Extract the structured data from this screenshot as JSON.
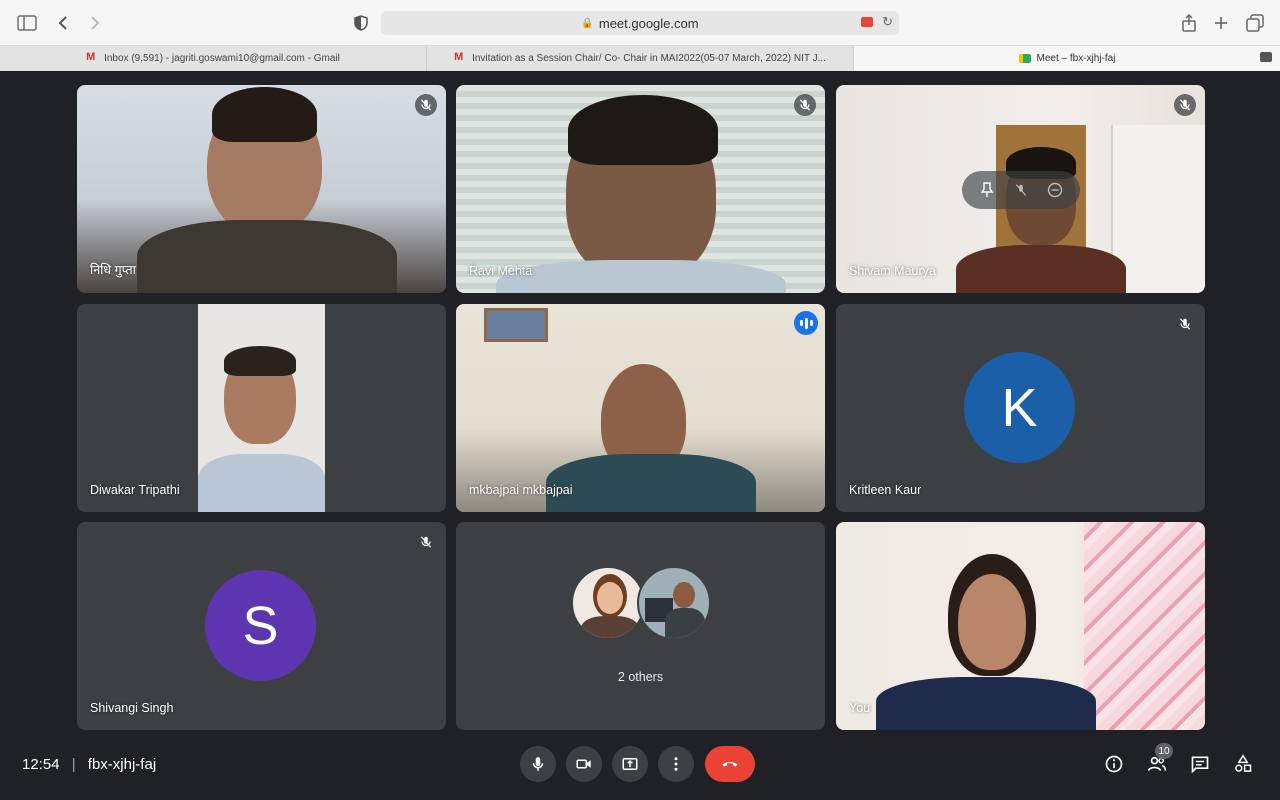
{
  "browser": {
    "url": "meet.google.com",
    "tabs": [
      {
        "label": "Inbox (9,591) - jagriti.goswami10@gmail.com - Gmail",
        "icon": "gmail-icon"
      },
      {
        "label": "Invitation as a Session Chair/ Co- Chair in MAI2022(05-07 March, 2022) NIT J...",
        "icon": "gmail-icon"
      },
      {
        "label": "Meet – fbx-xjhj-faj",
        "icon": "meet-icon"
      }
    ]
  },
  "participants": [
    {
      "name": "निधि गुप्ता",
      "muted": true
    },
    {
      "name": "Ravi Mehta",
      "muted": true
    },
    {
      "name": "Shivam Maurya",
      "muted": true
    },
    {
      "name": "Diwakar Tripathi",
      "muted": false
    },
    {
      "name": "mkbajpai mkbajpai",
      "muted": false,
      "speaking": true
    },
    {
      "name": "Kritleen Kaur",
      "muted": true,
      "initial": "K",
      "avatar_color": "#1a5fa8"
    },
    {
      "name": "Shivangi Singh",
      "muted": true,
      "initial": "S",
      "avatar_color": "#5e35b1"
    },
    {
      "name": "2 others"
    },
    {
      "name": "You"
    }
  ],
  "meeting": {
    "time": "12:54",
    "separator": "|",
    "code": "fbx-xjhj-faj",
    "participant_count": "10"
  },
  "colors": {
    "background": "#202124",
    "tile": "#3c4043",
    "speaking_outline": "#8ab4f8",
    "end_call": "#ea4335"
  }
}
